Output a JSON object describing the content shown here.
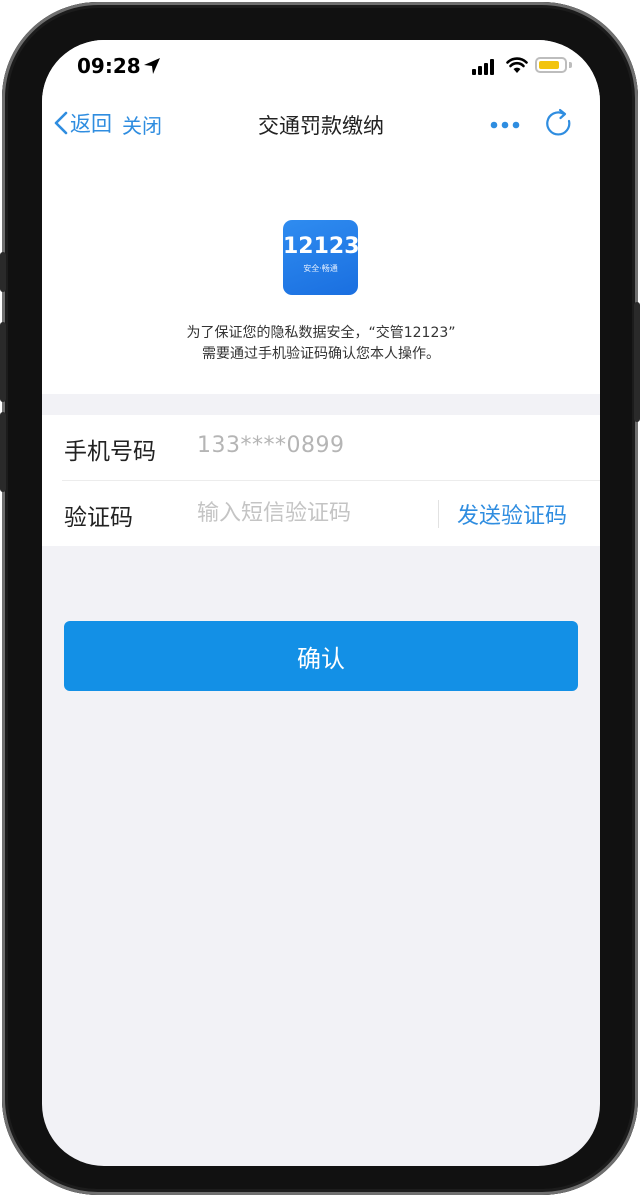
{
  "status_bar": {
    "time": "09:28",
    "battery_level": 0.85,
    "battery_color": "#f2c40f"
  },
  "nav": {
    "back_label": "返回",
    "close_label": "关闭",
    "title": "交通罚款缴纳",
    "more_icon": "more-dots-icon",
    "refresh_icon": "refresh-icon"
  },
  "app_logo": {
    "number": "12123",
    "slogan": "安全·畅通"
  },
  "notice": {
    "line1": "为了保证您的隐私数据安全，“交管12123”",
    "line2": "需要通过手机验证码确认您本人操作。"
  },
  "form": {
    "phone_label": "手机号码",
    "phone_value": "133****0899",
    "code_label": "验证码",
    "code_placeholder": "输入短信验证码",
    "code_value": "",
    "send_code_label": "发送验证码"
  },
  "confirm_label": "确认",
  "colors": {
    "accent": "#2f8de0",
    "button": "#1390e6",
    "page_background": "#f2f2f6"
  }
}
